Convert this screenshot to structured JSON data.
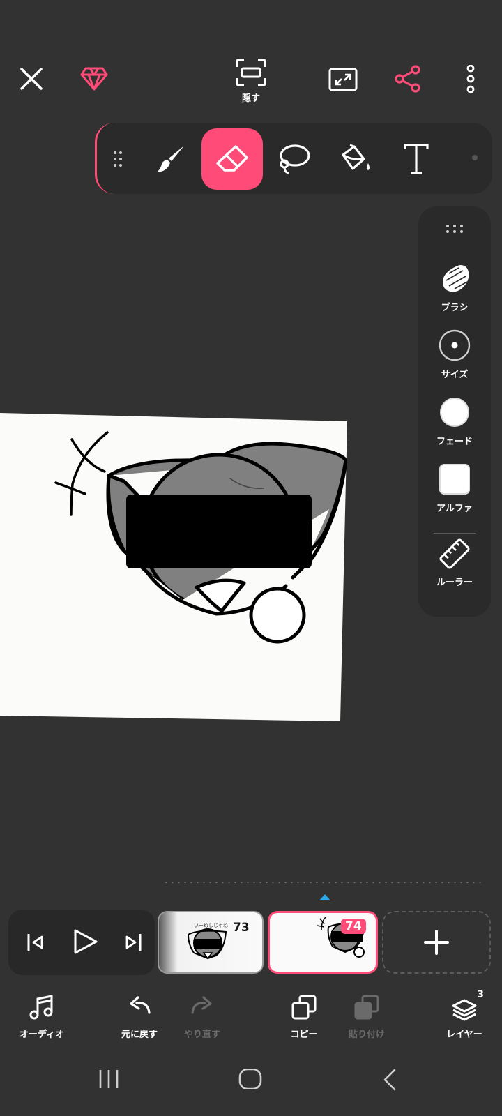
{
  "topbar": {
    "hide_label": "隠す",
    "icons": [
      "close-icon",
      "premium-diamond-icon",
      "hide-ui-icon",
      "fullscreen-icon",
      "share-icon",
      "more-vertical-icon"
    ]
  },
  "toolbar": {
    "tools": [
      "drag-handle-icon",
      "brush-icon",
      "eraser-icon",
      "lasso-icon",
      "fill-bucket-icon",
      "text-icon"
    ],
    "active_tool": "eraser"
  },
  "side_panel": {
    "brush_label": "ブラシ",
    "size_label": "サイズ",
    "fade_label": "フェード",
    "alpha_label": "アルファ",
    "ruler_label": "ルーラー"
  },
  "timeline": {
    "frames": [
      {
        "number": "73",
        "caption": "いーぬしじゃね"
      },
      {
        "number": "74"
      }
    ],
    "selected_frame": "74"
  },
  "actions": {
    "audio_label": "オーディオ",
    "undo_label": "元に戻す",
    "redo_label": "やり直す",
    "copy_label": "コピー",
    "paste_label": "貼り付け",
    "layers_label": "レイヤー",
    "layer_count": "3"
  },
  "colors": {
    "accent": "#ff4b78",
    "background": "#323232",
    "panel": "#2a2a2a",
    "playhead_marker": "#2aa7e8"
  }
}
